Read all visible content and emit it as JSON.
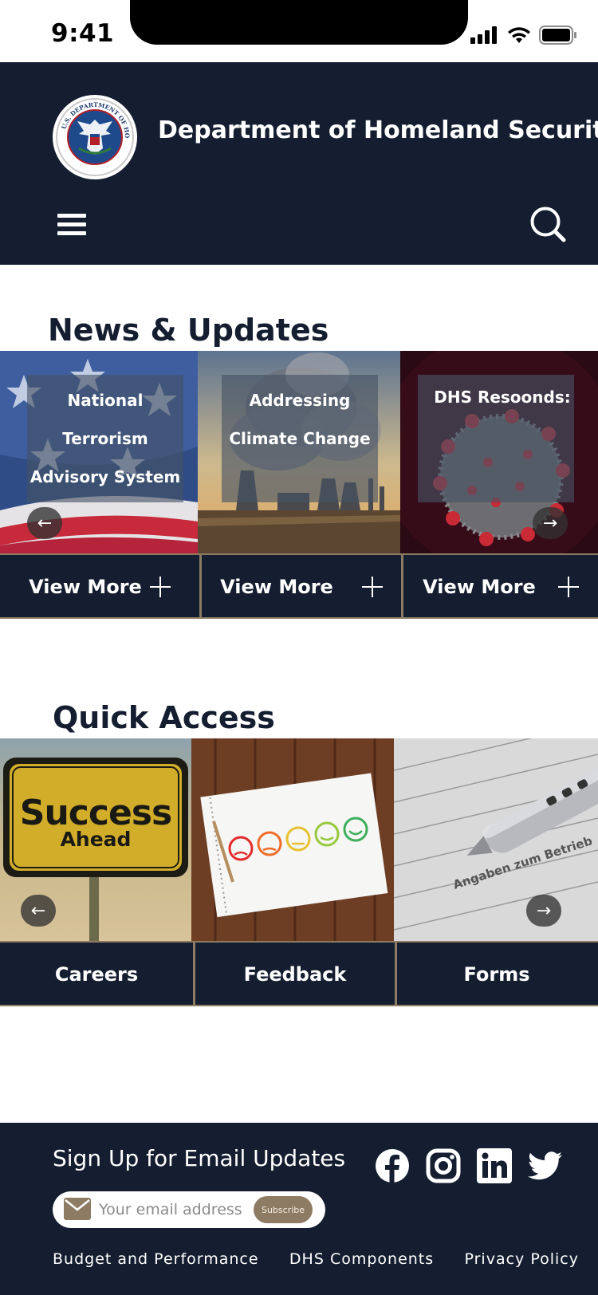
{
  "status_bar": {
    "time": "9:41"
  },
  "header": {
    "title": "Department of Homeland Security",
    "seal_text": "U.S. DEPARTMENT OF HOMELAND SECURITY"
  },
  "news": {
    "title": "News & Updates",
    "cards": [
      {
        "line1": "National",
        "line2": "Terrorism",
        "line3": "Advisory System",
        "button": "View More"
      },
      {
        "line1": "Addressing",
        "line2": "Climate Change",
        "button": "View More"
      },
      {
        "line1": "DHS Resoonds:",
        "button": "View More"
      }
    ],
    "prev_arrow": "←",
    "next_arrow": "→"
  },
  "quick_access": {
    "title": "Quick Access",
    "sign_line1": "Success",
    "sign_line2": "Ahead",
    "items": [
      "Careers",
      "Feedback",
      "Forms"
    ],
    "form_text": "Angaben zum Betrieb",
    "prev_arrow": "←",
    "next_arrow": "→"
  },
  "footer": {
    "signup_title": "Sign Up for Email Updates",
    "email_placeholder": "Your email address",
    "subscribe_label": "Subscribe",
    "links": [
      "Budget and Performance",
      "DHS Components",
      "Privacy Policy"
    ],
    "social_icons": [
      "facebook-icon",
      "instagram-icon",
      "linkedin-icon",
      "twitter-icon"
    ]
  },
  "colors": {
    "navy": "#141e30",
    "gold": "#8d7c63",
    "white": "#ffffff"
  }
}
